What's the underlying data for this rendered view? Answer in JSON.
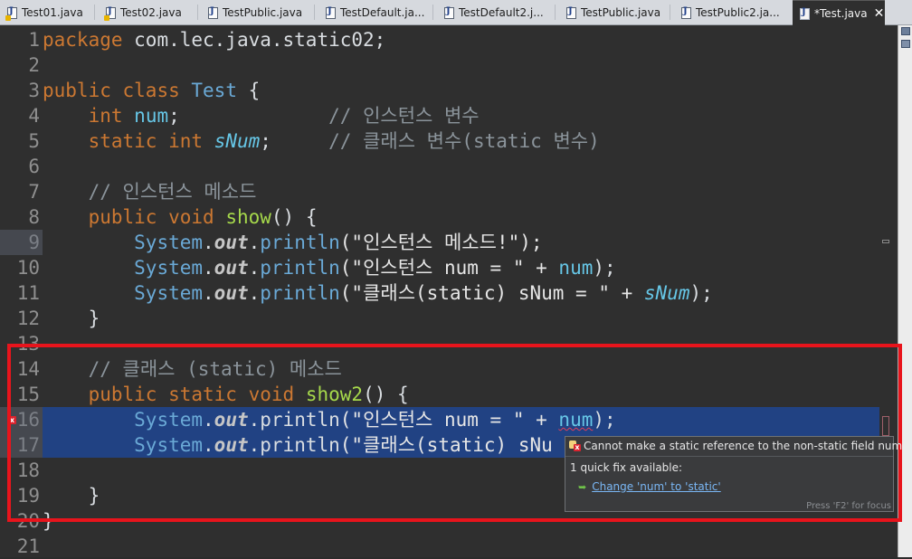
{
  "tabs": [
    {
      "label": "Test01.java",
      "active": false
    },
    {
      "label": "Test02.java",
      "active": false
    },
    {
      "label": "TestPublic.java",
      "active": false
    },
    {
      "label": "TestDefault.ja...",
      "active": false
    },
    {
      "label": "TestDefault2.j...",
      "active": false
    },
    {
      "label": "TestPublic.java",
      "active": false
    },
    {
      "label": "TestPublic2.ja...",
      "active": false
    },
    {
      "label": "*Test.java",
      "active": true
    }
  ],
  "tab_close_glyph": "✕",
  "code": {
    "line_numbers": [
      "1",
      "2",
      "3",
      "4",
      "5",
      "6",
      "7",
      "8",
      "9",
      "10",
      "11",
      "12",
      "13",
      "14",
      "15",
      "16",
      "17",
      "18",
      "19",
      "20",
      "21"
    ],
    "l1_package": "package",
    "l1_name": " com.lec.java.static02;",
    "l3_public": "public",
    "l3_class": "class",
    "l3_classname": "Test",
    "l3_brace": " {",
    "l4_type": "int",
    "l4_field": "num",
    "l4_semi": ";",
    "l4_comment": "// 인스턴스 변수",
    "l5_static": "static",
    "l5_type": "int",
    "l5_field": "sNum",
    "l5_semi": ";",
    "l5_comment": "// 클래스 변수(static 변수)",
    "l7_comment": "// 인스턴스 메소드",
    "l8_public": "public",
    "l8_void": "void",
    "l8_method": "show",
    "l8_rest": "() {",
    "system": "System",
    "dot": ".",
    "out": "out",
    "println": "println",
    "l9_args": "(\"인스턴스 메소드!\");",
    "l10_args": "(\"인스턴스 num = \" + ",
    "l10_field": "num",
    "l10_end": ");",
    "l11_args": "(\"클래스(static) sNum = \" + ",
    "l11_field": "sNum",
    "l11_end": ");",
    "close_brace": "}",
    "l14_comment": "// 클래스 (static) 메소드",
    "l15_public": "public",
    "l15_static": "static",
    "l15_void": "void",
    "l15_method": "show2",
    "l15_rest": "() {",
    "l16_args": "(\"인스턴스 num = \" + ",
    "l16_field": "num",
    "l16_end": ");",
    "l17_visible": "(\"클래스(static) sNu"
  },
  "error_gutter_glyph": "x",
  "popup": {
    "message": "Cannot make a static reference to the non-static field num",
    "quick_fix_count": "1 quick fix available:",
    "fix_arrow": "➥",
    "fix_label": "Change 'num' to 'static'",
    "hint": "Press 'F2' for focus"
  },
  "colors": {
    "highlight_box": "#e8141c",
    "selection": "#214283",
    "keyword": "#cc7832"
  }
}
